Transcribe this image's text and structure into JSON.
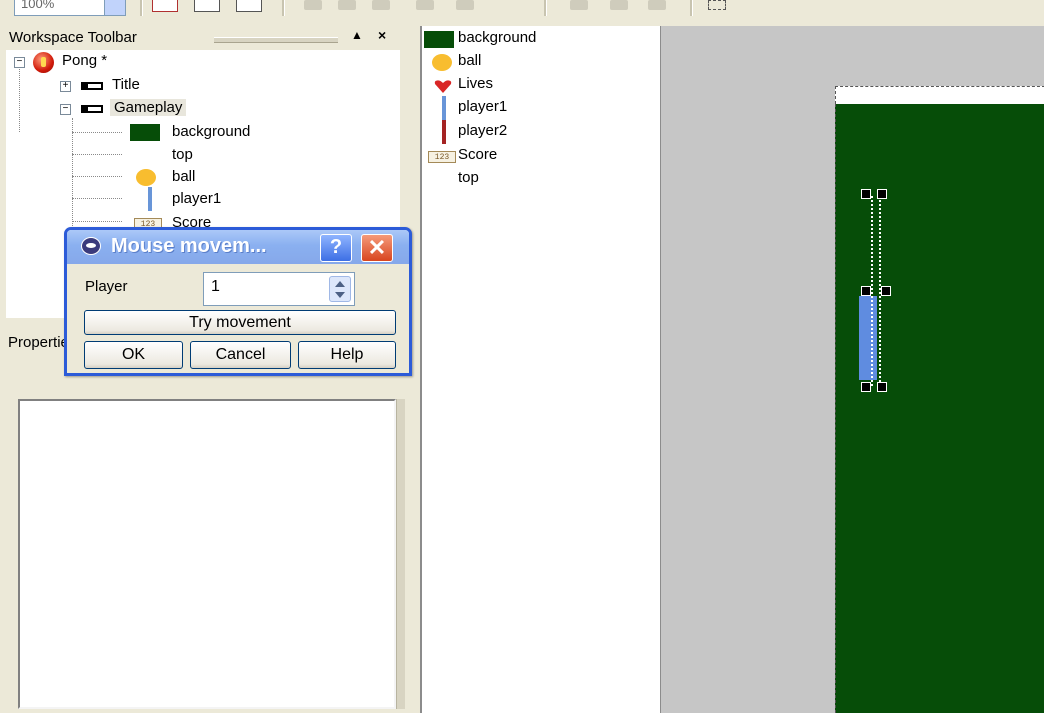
{
  "toolbar": {
    "zoom_value": "100%"
  },
  "workspace": {
    "title": "Workspace Toolbar",
    "collapse_glyph": "▲",
    "close_glyph": "×",
    "tree": {
      "app": "Pong *",
      "frames": [
        {
          "label": "Title"
        },
        {
          "label": "Gameplay"
        }
      ],
      "objects": [
        {
          "label": "background",
          "icon": "background-swatch-icon"
        },
        {
          "label": "top",
          "icon": "none"
        },
        {
          "label": "ball",
          "icon": "ball-icon"
        },
        {
          "label": "player1",
          "icon": "paddle-icon"
        },
        {
          "label": "Score",
          "icon": "score-counter-icon"
        }
      ]
    }
  },
  "properties": {
    "title": "Properties"
  },
  "object_list": {
    "items": [
      {
        "label": "background",
        "icon": "background-swatch-icon"
      },
      {
        "label": "ball",
        "icon": "ball-icon"
      },
      {
        "label": "Lives",
        "icon": "heart-icon"
      },
      {
        "label": "player1",
        "icon": "paddle-icon"
      },
      {
        "label": "player2",
        "icon": "paddle-icon"
      },
      {
        "label": "Score",
        "icon": "score-counter-icon"
      },
      {
        "label": "top",
        "icon": "none"
      }
    ]
  },
  "dialog": {
    "title": "Mouse movem...",
    "help_glyph": "?",
    "close_glyph": "✕",
    "player_label": "Player",
    "player_value": "1",
    "try_label": "Try movement",
    "ok_label": "OK",
    "cancel_label": "Cancel",
    "help_label": "Help"
  },
  "colors": {
    "background_green": "#064d08",
    "ball_yellow": "#f8bd2f",
    "paddle_blue": "#6895d8",
    "paddle_red": "#a42323",
    "dialog_border": "#2c5bd8"
  }
}
